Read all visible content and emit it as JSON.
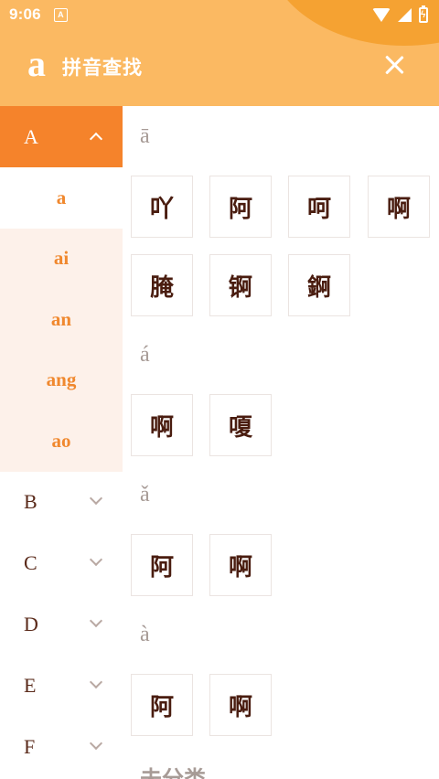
{
  "status_bar": {
    "time": "9:06",
    "notification_glyph": "A",
    "battery_glyph": "ϟ"
  },
  "header": {
    "logo": "a",
    "title": "拼音查找",
    "colors": {
      "header": "#fbb962",
      "accent": "#f5832b"
    }
  },
  "sidebar": {
    "active_letter": "A",
    "subitems": [
      "a",
      "ai",
      "an",
      "ang",
      "ao"
    ],
    "selected_subitem": "a",
    "letters_collapsed": [
      "B",
      "C",
      "D",
      "E",
      "F"
    ]
  },
  "content": {
    "sections": [
      {
        "tone": "ā",
        "chars": [
          "吖",
          "阿",
          "呵",
          "啊",
          "腌",
          "锕",
          "錒"
        ]
      },
      {
        "tone": "á",
        "chars": [
          "啊",
          "嗄"
        ]
      },
      {
        "tone": "ǎ",
        "chars": [
          "阿",
          "啊"
        ]
      },
      {
        "tone": "à",
        "chars": [
          "阿",
          "啊"
        ]
      }
    ],
    "footer_partial": "未分类"
  }
}
